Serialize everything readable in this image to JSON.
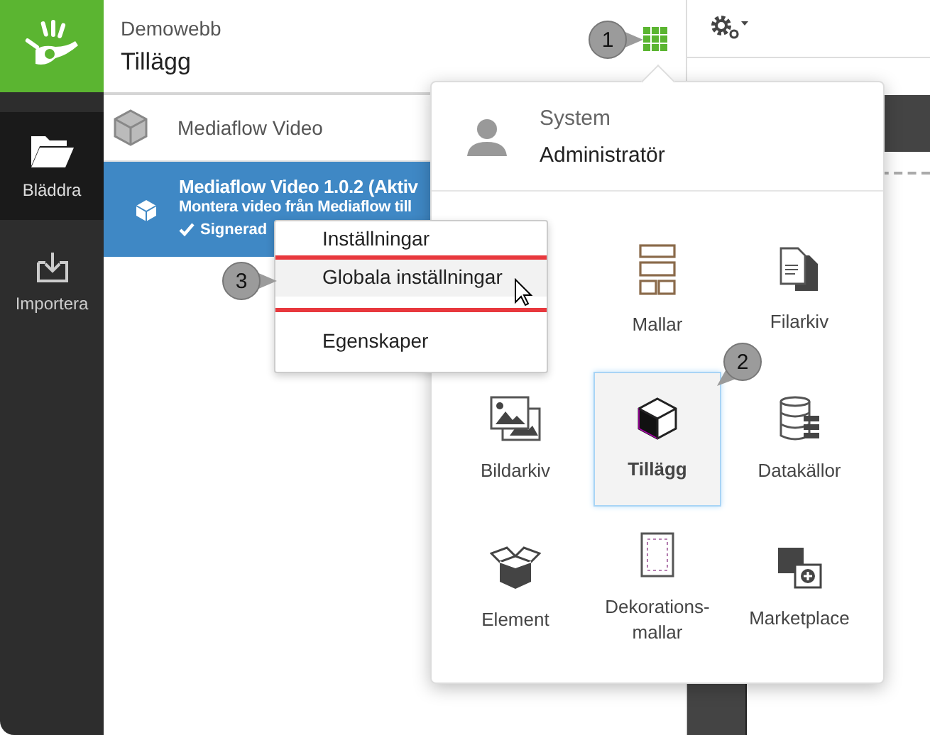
{
  "sidebar": {
    "items": [
      {
        "label": "Bläddra",
        "kind": "folder",
        "selected": true
      },
      {
        "label": "Importera",
        "kind": "import",
        "selected": false
      }
    ]
  },
  "header": {
    "site": "Demowebb",
    "page": "Tillägg"
  },
  "list": {
    "items": [
      {
        "title": "Mediaflow Video",
        "selected": false
      },
      {
        "title": "Mediaflow Video 1.0.2 (Aktiv",
        "description": "Montera video från Mediaflow till",
        "status": "Signerad",
        "selected": true
      }
    ]
  },
  "context_menu": {
    "items": [
      {
        "label": "Inställningar",
        "selected": false,
        "annotated": false
      },
      {
        "label": "Globala inställningar",
        "selected": true,
        "annotated": true
      },
      {
        "label": "Egenskaper",
        "selected": false,
        "annotated": false
      }
    ]
  },
  "app_menu": {
    "user": {
      "name": "System",
      "role": "Administratör"
    },
    "tiles": [
      {
        "label": "Mallar",
        "kind": "layout",
        "selected": false
      },
      {
        "label": "Filarkiv",
        "kind": "files",
        "selected": false
      },
      {
        "label": "Bildarkiv",
        "kind": "images",
        "selected": false
      },
      {
        "label": "Tillägg",
        "kind": "cube",
        "selected": true
      },
      {
        "label": "Datakällor",
        "kind": "database",
        "selected": false
      },
      {
        "label": "Element",
        "kind": "box",
        "selected": false
      },
      {
        "label": "Dekorations-mallar",
        "kind": "frame",
        "selected": false
      },
      {
        "label": "Marketplace",
        "kind": "market",
        "selected": false
      }
    ]
  },
  "callouts": [
    {
      "number": "1"
    },
    {
      "number": "2"
    },
    {
      "number": "3"
    }
  ]
}
